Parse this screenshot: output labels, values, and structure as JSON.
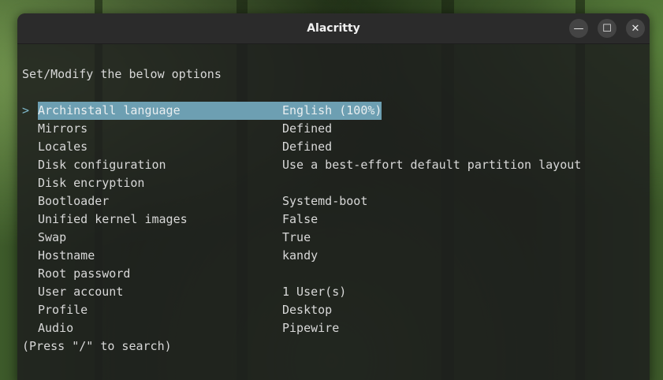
{
  "window": {
    "title": "Alacritty",
    "buttons": {
      "minimize": "—",
      "maximize": "☐",
      "close": "✕"
    }
  },
  "terminal": {
    "header": "Set/Modify the below options",
    "cursor_symbol": ">",
    "menu": [
      {
        "label": "Archinstall language",
        "value": "English (100%)",
        "selected": true
      },
      {
        "label": "Mirrors",
        "value": "Defined"
      },
      {
        "label": "Locales",
        "value": "Defined"
      },
      {
        "label": "Disk configuration",
        "value": "Use a best-effort default partition layout"
      },
      {
        "label": "Disk encryption",
        "value": ""
      },
      {
        "label": "Bootloader",
        "value": "Systemd-boot"
      },
      {
        "label": "Unified kernel images",
        "value": "False"
      },
      {
        "label": "Swap",
        "value": "True"
      },
      {
        "label": "Hostname",
        "value": "kandy"
      },
      {
        "label": "Root password",
        "value": ""
      },
      {
        "label": "User account",
        "value": "1 User(s)"
      },
      {
        "label": "Profile",
        "value": "Desktop"
      },
      {
        "label": "Audio",
        "value": "Pipewire"
      }
    ],
    "footer": "(Press \"/\" to search)"
  }
}
